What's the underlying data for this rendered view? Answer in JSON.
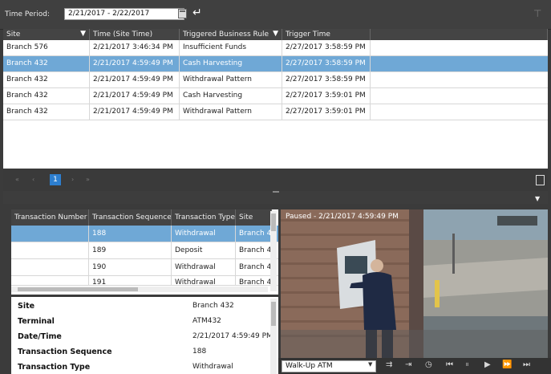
{
  "toolbar": {
    "time_period_label": "Time Period:",
    "time_period_value": "2/21/2017 - 2/22/2017"
  },
  "alerts_table": {
    "columns": [
      "Site",
      "Time (Site Time)",
      "Triggered Business Rule",
      "Trigger Time"
    ],
    "rows": [
      [
        "Branch 576",
        "2/21/2017 3:46:34 PM",
        "Insufficient Funds",
        "2/27/2017 3:58:59 PM"
      ],
      [
        "Branch 432",
        "2/21/2017 4:59:49 PM",
        "Cash Harvesting",
        "2/27/2017 3:58:59 PM"
      ],
      [
        "Branch 432",
        "2/21/2017 4:59:49 PM",
        "Withdrawal Pattern",
        "2/27/2017 3:58:59 PM"
      ],
      [
        "Branch 432",
        "2/21/2017 4:59:49 PM",
        "Cash Harvesting",
        "2/27/2017 3:59:01 PM"
      ],
      [
        "Branch 432",
        "2/21/2017 4:59:49 PM",
        "Withdrawal Pattern",
        "2/27/2017 3:59:01 PM"
      ]
    ],
    "selected_row": 1
  },
  "pager": {
    "first": "«",
    "prev": "‹",
    "current_page": "1",
    "next": "›",
    "last": "»"
  },
  "transactions_table": {
    "columns": [
      "Transaction Number",
      "Transaction Sequence",
      "Transaction Type",
      "Site"
    ],
    "rows": [
      [
        "",
        "188",
        "Withdrawal",
        "Branch 4"
      ],
      [
        "",
        "189",
        "Deposit",
        "Branch 4"
      ],
      [
        "",
        "190",
        "Withdrawal",
        "Branch 4"
      ],
      [
        "",
        "191",
        "Withdrawal",
        "Branch 4"
      ]
    ],
    "selected_row": 0
  },
  "details": {
    "rows": [
      {
        "key": "Site",
        "value": "Branch 432"
      },
      {
        "key": "Terminal",
        "value": "ATM432"
      },
      {
        "key": "Date/Time",
        "value": "2/21/2017 4:59:49 PM"
      },
      {
        "key": "Transaction Sequence",
        "value": "188"
      },
      {
        "key": "Transaction Type",
        "value": "Withdrawal"
      }
    ]
  },
  "video": {
    "status": "Paused - 2/21/2017 4:59:49 PM",
    "camera": "Walk-Up ATM"
  },
  "colors": {
    "accent": "#2d7fd0",
    "selection": "#6fa8d6",
    "header_bg": "#444444"
  }
}
